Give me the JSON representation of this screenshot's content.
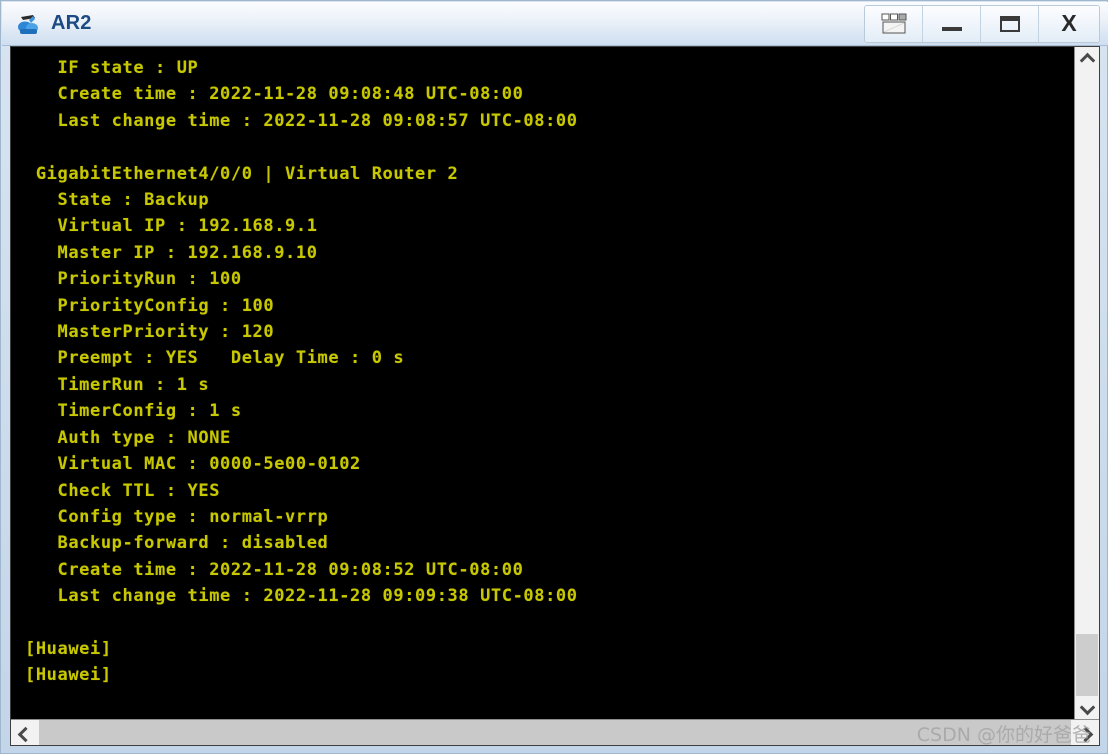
{
  "window": {
    "title": "AR2",
    "app_icon": "router-icon"
  },
  "titlebar_buttons": [
    {
      "name": "cascade-button",
      "icon": "cascade-windows-icon",
      "label": ""
    },
    {
      "name": "minimize-button",
      "icon": "minimize-icon",
      "label": ""
    },
    {
      "name": "maximize-button",
      "icon": "maximize-icon",
      "label": ""
    },
    {
      "name": "close-button",
      "icon": "close-icon",
      "label": "X"
    }
  ],
  "terminal": {
    "content": "   IF state : UP\n   Create time : 2022-11-28 09:08:48 UTC-08:00\n   Last change time : 2022-11-28 09:08:57 UTC-08:00\n\n GigabitEthernet4/0/0 | Virtual Router 2\n   State : Backup\n   Virtual IP : 192.168.9.1\n   Master IP : 192.168.9.10\n   PriorityRun : 100\n   PriorityConfig : 100\n   MasterPriority : 120\n   Preempt : YES   Delay Time : 0 s\n   TimerRun : 1 s\n   TimerConfig : 1 s\n   Auth type : NONE\n   Virtual MAC : 0000-5e00-0102\n   Check TTL : YES\n   Config type : normal-vrrp\n   Backup-forward : disabled\n   Create time : 2022-11-28 09:08:52 UTC-08:00\n   Last change time : 2022-11-28 09:09:38 UTC-08:00\n\n[Huawei]\n[Huawei]",
    "lines": [
      "   IF state : UP",
      "   Create time : 2022-11-28 09:08:48 UTC-08:00",
      "   Last change time : 2022-11-28 09:08:57 UTC-08:00",
      "",
      " GigabitEthernet4/0/0 | Virtual Router 2",
      "   State : Backup",
      "   Virtual IP : 192.168.9.1",
      "   Master IP : 192.168.9.10",
      "   PriorityRun : 100",
      "   PriorityConfig : 100",
      "   MasterPriority : 120",
      "   Preempt : YES   Delay Time : 0 s",
      "   TimerRun : 1 s",
      "   TimerConfig : 1 s",
      "   Auth type : NONE",
      "   Virtual MAC : 0000-5e00-0102",
      "   Check TTL : YES",
      "   Config type : normal-vrrp",
      "   Backup-forward : disabled",
      "   Create time : 2022-11-28 09:08:52 UTC-08:00",
      "   Last change time : 2022-11-28 09:09:38 UTC-08:00",
      "",
      "[Huawei]",
      "[Huawei]"
    ],
    "text_color": "#c8c800",
    "background_color": "#000000"
  },
  "scrollbars": {
    "vertical": {
      "up_icon": "chevron-up-icon",
      "down_icon": "chevron-down-icon",
      "thumb_position": "bottom"
    },
    "horizontal": {
      "left_icon": "chevron-left-icon",
      "right_icon": "chevron-right-icon",
      "thumb_position": "full"
    }
  },
  "watermark": {
    "text": "CSDN @你的好爸爸"
  }
}
